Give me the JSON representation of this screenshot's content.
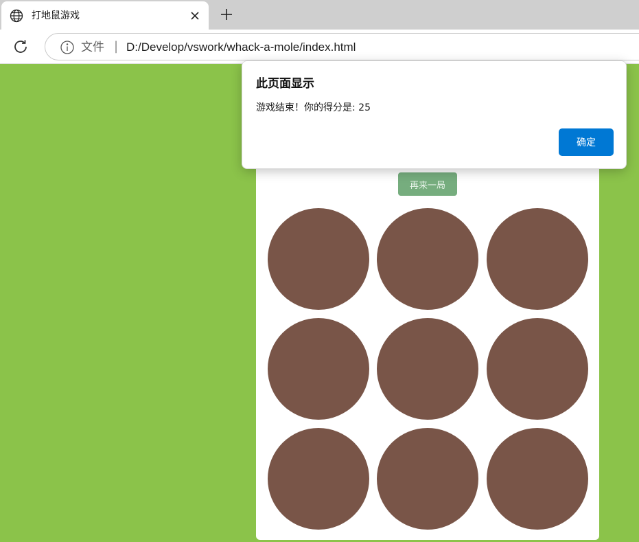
{
  "browser": {
    "tab": {
      "title": "打地鼠游戏",
      "icon": "globe-icon"
    },
    "address_bar": {
      "scheme_label": "文件",
      "separator": "|",
      "url": "D:/Develop/vswork/whack-a-mole/index.html"
    }
  },
  "game": {
    "restart_label": "再来一局",
    "holes": [
      "",
      "",
      "",
      "",
      "",
      "",
      "",
      "",
      ""
    ],
    "colors": {
      "background": "#8bc34a",
      "hole": "#795548",
      "restart": "#76ad7e"
    }
  },
  "dialog": {
    "title": "此页面显示",
    "message": "游戏结束！你的得分是: 25",
    "ok_label": "确定",
    "ok_color": "#0078d4"
  }
}
